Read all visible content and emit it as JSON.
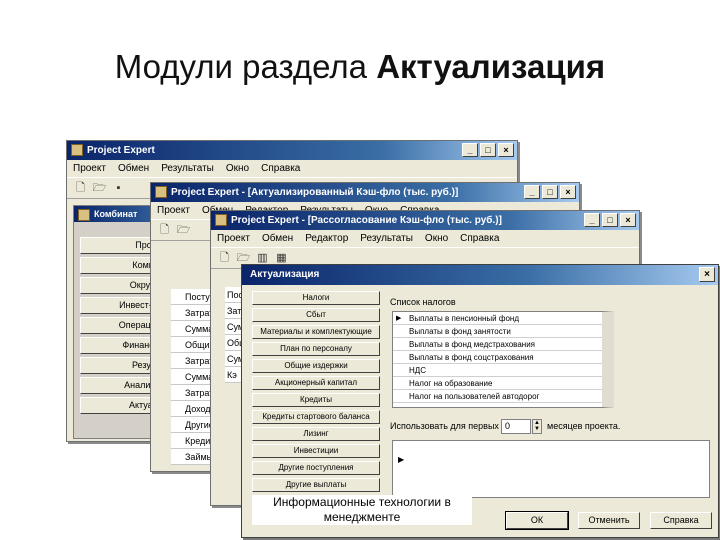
{
  "slide": {
    "title_prefix": "Модули раздела ",
    "title_bold": "Актуализация",
    "caption": "Информационные технологии в менеджменте"
  },
  "win1": {
    "title": "Project Expert",
    "menu": [
      "Проект",
      "Обмен",
      "Результаты",
      "Окно",
      "Справка"
    ],
    "child_title": "Комбинат",
    "side": [
      "Проек",
      "Компан",
      "Окружен",
      "Инвест-ционн",
      "Операционны",
      "Финансиров",
      "Результ",
      "Анализ про",
      "Актуализ"
    ]
  },
  "win2": {
    "title": "Project Expert - [Актуализированный Кэш-фло (тыс. руб.)]",
    "menu": [
      "Проект",
      "Обмен",
      "Редактор",
      "Результаты",
      "Окно",
      "Справка"
    ],
    "list": [
      "Поступлен",
      "Затраты",
      "Суммарн",
      "Общие и",
      "Затраты",
      "Суммарн",
      "Затраты",
      "Доходы",
      "Другие",
      "Кредиты",
      "Займы"
    ]
  },
  "win3": {
    "title": "Project Expert - [Рассогласование Кэш-фло (тыс. руб.)]",
    "menu": [
      "Проект",
      "Обмен",
      "Редактор",
      "Результаты",
      "Окно",
      "Справка"
    ],
    "list": [
      "Пост",
      "Затр",
      "Сум",
      "Обши",
      "Сум",
      "Кэ"
    ]
  },
  "dialog": {
    "title": "Актуализация",
    "close": "×",
    "modules": [
      "Налоги",
      "Сбыт",
      "Материалы и комплектующие",
      "План по персоналу",
      "Общие издержки",
      "Акционерный капитал",
      "Кредиты",
      "Кредиты стартового баланса",
      "Лизинг",
      "Инвестиции",
      "Другие поступления",
      "Другие выплаты"
    ],
    "tax_list_label": "Список налогов",
    "taxes": [
      "Выплаты в пенсионный фонд",
      "Выплаты в фонд занятости",
      "Выплаты в фонд медстрахования",
      "Выплаты в фонд соцстрахования",
      "НДС",
      "Налог на образование",
      "Налог на пользователей автодорог"
    ],
    "use_label": "Использовать для первых",
    "months_value": "0",
    "months_label": "месяцев проекта.",
    "buttons": {
      "ok": "ОК",
      "cancel": "Отменить",
      "help": "Справка"
    }
  }
}
